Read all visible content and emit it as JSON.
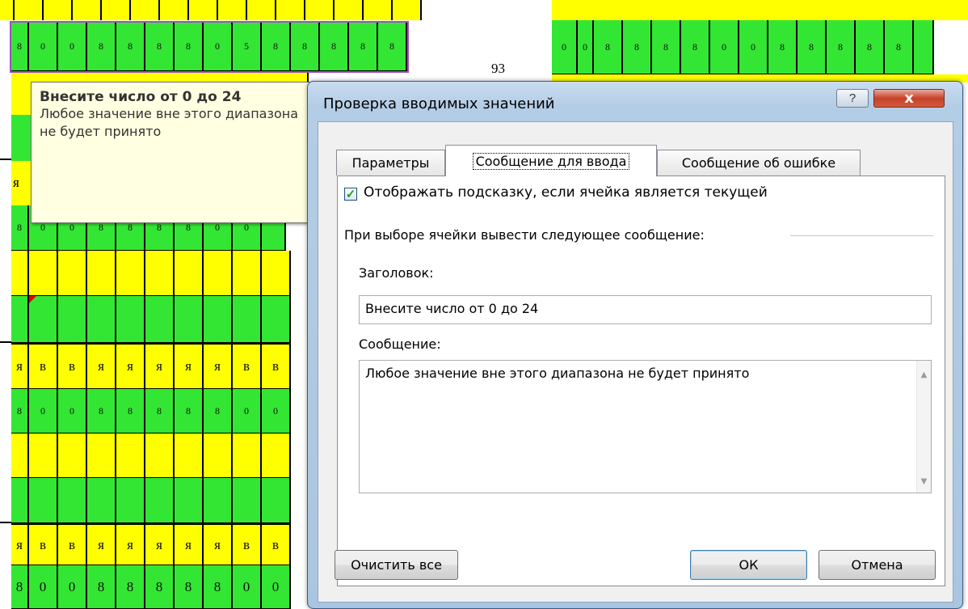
{
  "spreadsheet": {
    "top_left_row": [
      "8",
      "0",
      "0",
      "8",
      "8",
      "8",
      "8",
      "0",
      "5",
      "8",
      "8",
      "8",
      "8",
      "8"
    ],
    "top_right_row": [
      "0",
      "0",
      "8",
      "8",
      "8",
      "8",
      "0",
      "0",
      "8",
      "8",
      "8",
      "8",
      "8"
    ],
    "cell_number": "93",
    "row_r": [
      "8",
      "0",
      "0",
      "8",
      "8",
      "8",
      "8",
      "0",
      "0"
    ],
    "row_letters": [
      "я",
      "в",
      "в",
      "я",
      "я",
      "я",
      "я",
      "я",
      "в",
      "в"
    ],
    "row_digits": [
      "8",
      "0",
      "0",
      "8",
      "8",
      "8",
      "8",
      "8",
      "0",
      "0"
    ],
    "row_letter_single": "я",
    "colors": {
      "yellow": "#ffff00",
      "green": "#33e633"
    }
  },
  "tooltip": {
    "title": "Внесите число от 0 до 24",
    "message": "Любое значение вне этого диапазона не будет принято"
  },
  "dialog": {
    "title": "Проверка вводимых значений",
    "help_icon": "?",
    "close_icon": "x",
    "tabs": [
      {
        "label": "Параметры",
        "active": false
      },
      {
        "label": "Сообщение для ввода",
        "active": true
      },
      {
        "label": "Сообщение об ошибке",
        "active": false
      }
    ],
    "checkbox": {
      "label": "Отображать подсказку, если ячейка является текущей",
      "checked": true
    },
    "group_label": "При выборе ячейки вывести следующее сообщение:",
    "title_field": {
      "label": "Заголовок:",
      "value": "Внесите число от 0 до 24"
    },
    "message_field": {
      "label": "Сообщение:",
      "value": "Любое значение вне этого диапазона не будет принято"
    },
    "buttons": {
      "clear_all": "Очистить все",
      "ok": "ОК",
      "cancel": "Отмена"
    }
  }
}
